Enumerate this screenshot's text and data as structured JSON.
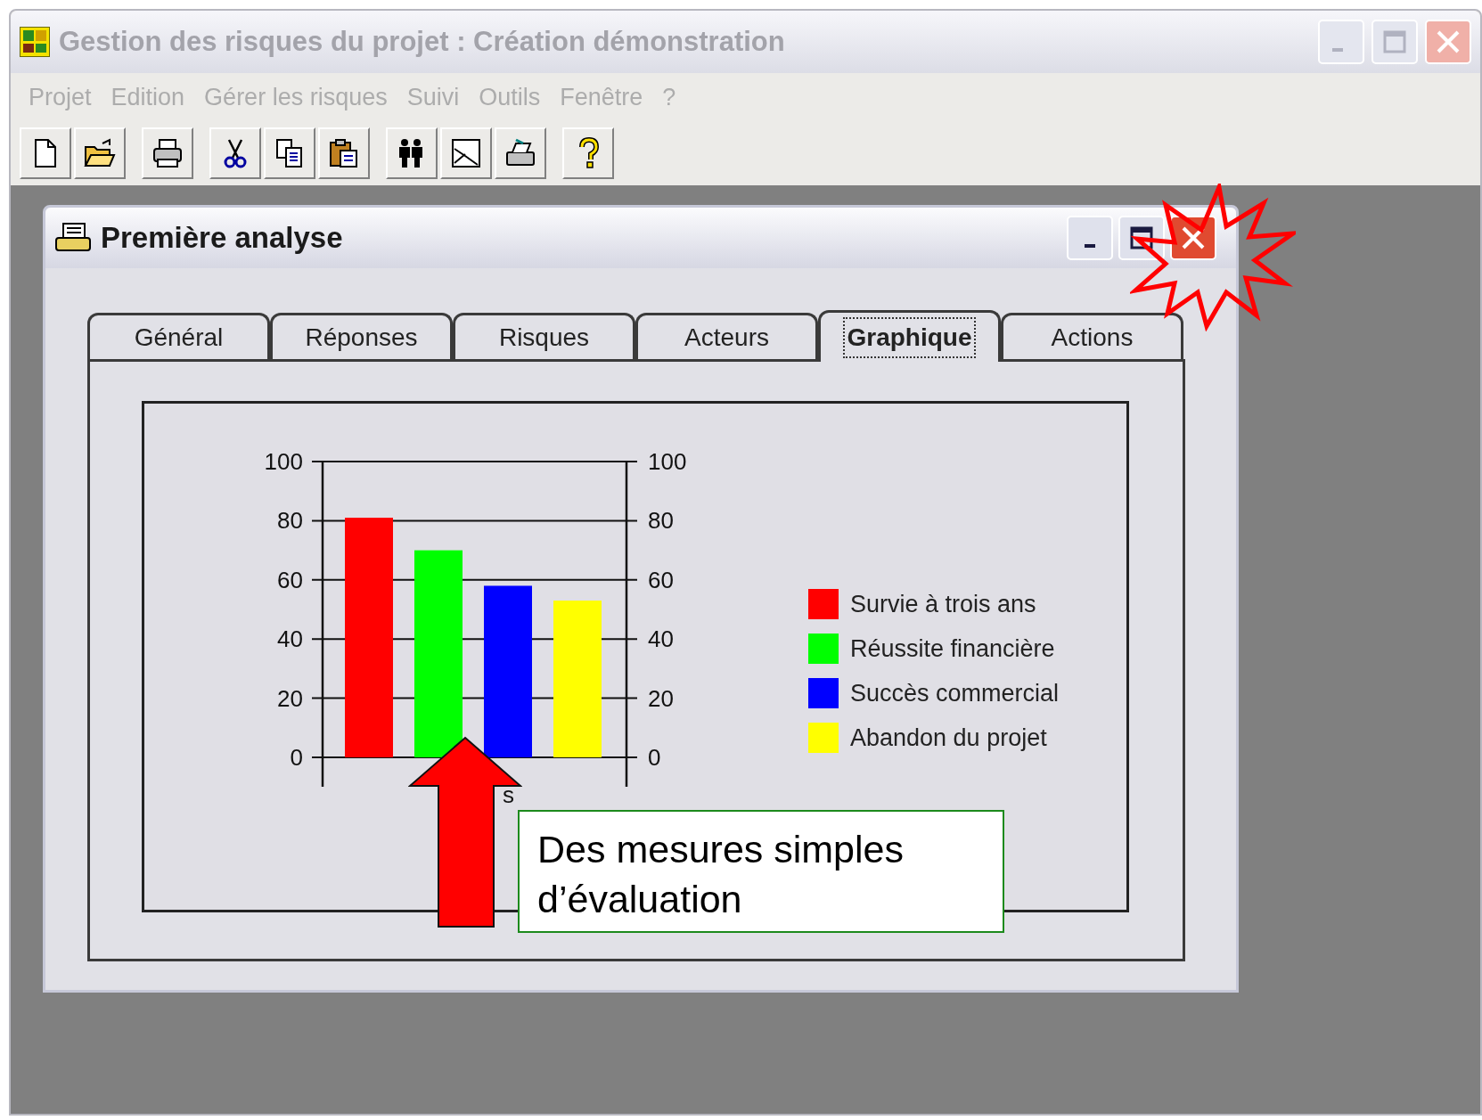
{
  "window": {
    "title": "Gestion des risques du projet : Création démonstration",
    "active": false
  },
  "menu": [
    {
      "label": "Projet",
      "disabled": true
    },
    {
      "label": "Edition",
      "disabled": true
    },
    {
      "label": "Gérer les risques",
      "disabled": true
    },
    {
      "label": "Suivi",
      "disabled": true
    },
    {
      "label": "Outils",
      "disabled": true
    },
    {
      "label": "Fenêtre",
      "disabled": true
    },
    {
      "label": "?",
      "disabled": true
    }
  ],
  "toolbar": [
    [
      {
        "kind": "new"
      },
      {
        "kind": "open"
      }
    ],
    [
      {
        "kind": "print"
      }
    ],
    [
      {
        "kind": "cut"
      },
      {
        "kind": "copy"
      },
      {
        "kind": "paste"
      }
    ],
    [
      {
        "kind": "people"
      },
      {
        "kind": "graph"
      },
      {
        "kind": "printer"
      }
    ],
    [
      {
        "kind": "help"
      }
    ]
  ],
  "child_window": {
    "title": "Première analyse",
    "tabs": [
      {
        "label": "Général",
        "selected": false
      },
      {
        "label": "Réponses",
        "selected": false
      },
      {
        "label": "Risques",
        "selected": false
      },
      {
        "label": "Acteurs",
        "selected": false
      },
      {
        "label": "Graphique",
        "selected": true
      },
      {
        "label": "Actions",
        "selected": false
      }
    ],
    "chart_data": {
      "type": "bar",
      "xlabel": "s",
      "ylim": [
        0,
        100
      ],
      "yticks": [
        0,
        20,
        40,
        60,
        80,
        100
      ],
      "y2lim": [
        0,
        100
      ],
      "y2ticks": [
        0,
        20,
        40,
        60,
        80,
        100
      ],
      "grid": true,
      "legend": true,
      "series": [
        {
          "name": "Survie à trois ans",
          "color": "#ff0000",
          "values": [
            81
          ]
        },
        {
          "name": "Réussite financière",
          "color": "#00ff00",
          "values": [
            70
          ]
        },
        {
          "name": "Succès commercial",
          "color": "#0000ff",
          "values": [
            58
          ]
        },
        {
          "name": "Abandon du projet",
          "color": "#ffff00",
          "values": [
            53
          ]
        }
      ]
    }
  },
  "annotation": {
    "callout": "Des mesures simples d’évaluation"
  }
}
